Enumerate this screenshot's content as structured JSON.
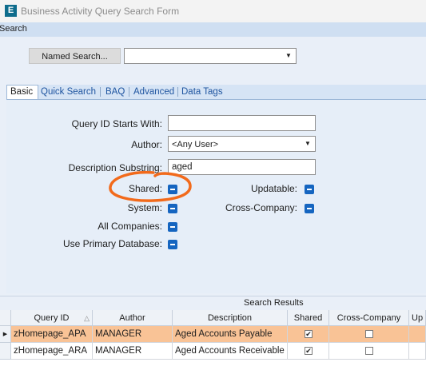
{
  "window": {
    "title": "Business Activity Query Search Form",
    "app_icon": "E"
  },
  "search_header": "Search",
  "named_search": {
    "button_label": "Named Search...",
    "value": ""
  },
  "tabs": [
    "Basic",
    "Quick Search",
    "BAQ",
    "Advanced",
    "Data Tags"
  ],
  "form": {
    "query_id_label": "Query ID Starts With:",
    "query_id_value": "",
    "author_label": "Author:",
    "author_value": "<Any User>",
    "description_label": "Description Substring:",
    "description_value": "aged",
    "shared_label": "Shared:",
    "updatable_label": "Updatable:",
    "system_label": "System:",
    "cross_company_label": "Cross-Company:",
    "all_companies_label": "All Companies:",
    "use_primary_db_label": "Use Primary Database:"
  },
  "annotation_color": "#f26a1b",
  "results": {
    "title": "Search Results",
    "columns": [
      "Query ID",
      "Author",
      "Description",
      "Shared",
      "Cross-Company",
      "Up"
    ],
    "rows": [
      {
        "query_id": "zHomepage_APA",
        "author": "MANAGER",
        "description": "Aged Accounts Payable",
        "shared": true,
        "cross_company": false
      },
      {
        "query_id": "zHomepage_ARA",
        "author": "MANAGER",
        "description": "Aged Accounts Receivable",
        "shared": true,
        "cross_company": false
      }
    ]
  }
}
